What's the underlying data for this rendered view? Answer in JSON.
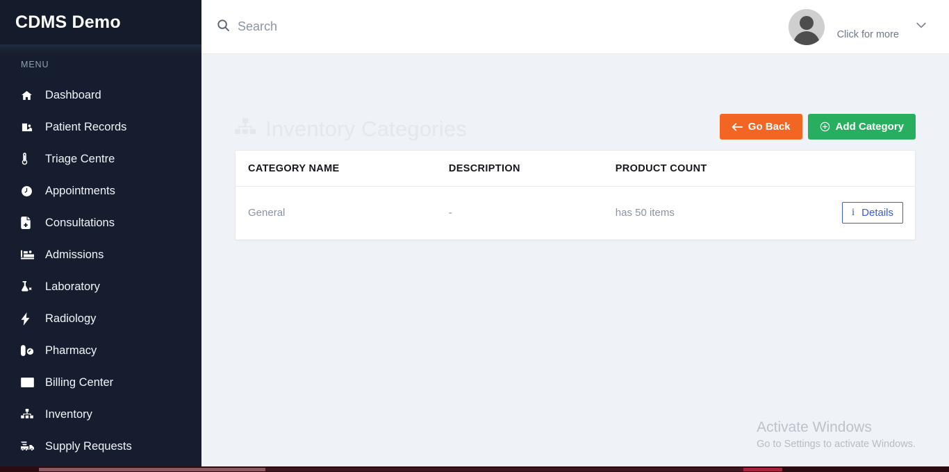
{
  "brand": {
    "name": "CDMS Demo"
  },
  "sidebar": {
    "menu_label": "MENU",
    "items": [
      {
        "label": "Dashboard",
        "icon": "home-icon"
      },
      {
        "label": "Patient Records",
        "icon": "id-card-icon"
      },
      {
        "label": "Triage Centre",
        "icon": "thermometer-icon"
      },
      {
        "label": "Appointments",
        "icon": "clock-icon"
      },
      {
        "label": "Consultations",
        "icon": "file-medical-icon"
      },
      {
        "label": "Admissions",
        "icon": "hospital-bed-icon"
      },
      {
        "label": "Laboratory",
        "icon": "flask-icon"
      },
      {
        "label": "Radiology",
        "icon": "bolt-icon"
      },
      {
        "label": "Pharmacy",
        "icon": "pills-icon"
      },
      {
        "label": "Billing Center",
        "icon": "invoice-icon"
      },
      {
        "label": "Inventory",
        "icon": "sitemap-boxes-icon"
      },
      {
        "label": "Supply Requests",
        "icon": "truck-icon"
      }
    ]
  },
  "topbar": {
    "search": {
      "placeholder": "Search",
      "value": "",
      "icon": "search-icon"
    },
    "user": {
      "label": "Click for more",
      "avatar": "avatar",
      "caret": "chevron-down-icon"
    }
  },
  "page": {
    "title": "Inventory Categories",
    "title_icon": "sitemap-icon",
    "actions": {
      "go_back": {
        "label": "Go Back",
        "icon": "arrow-left-icon",
        "color": "#f26522"
      },
      "add_category": {
        "label": "Add Category",
        "icon": "plus-circle-icon",
        "color": "#27ae5f"
      }
    }
  },
  "table": {
    "columns": [
      "CATEGORY NAME",
      "DESCRIPTION",
      "PRODUCT COUNT",
      ""
    ],
    "rows": [
      {
        "category_name": "General",
        "description": "-",
        "product_count": "has 50 items",
        "action": {
          "label": "Details",
          "icon": "info-icon"
        }
      }
    ]
  },
  "watermark": {
    "title": "Activate Windows",
    "subtitle": "Go to Settings to activate Windows."
  }
}
